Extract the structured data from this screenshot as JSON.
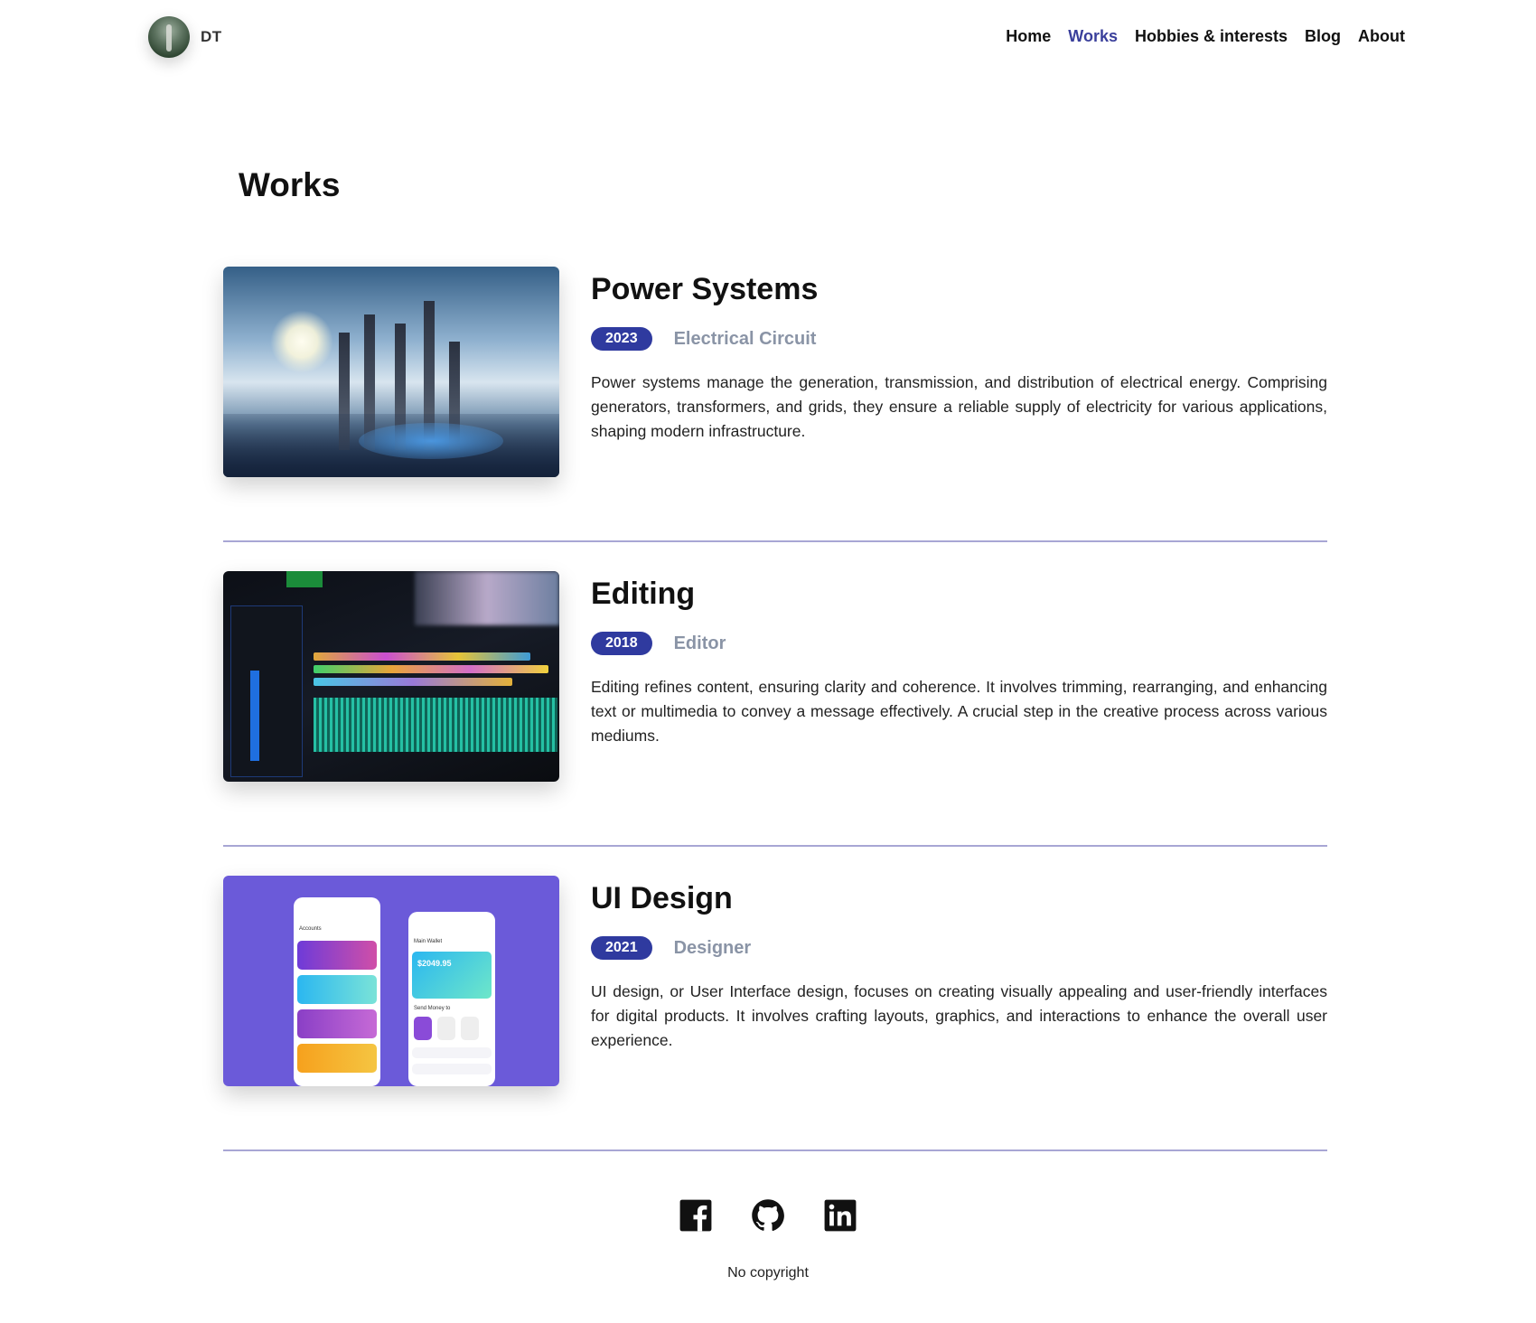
{
  "header": {
    "brand": "DT",
    "nav": [
      {
        "label": "Home"
      },
      {
        "label": "Works",
        "active": true
      },
      {
        "label": "Hobbies & interests"
      },
      {
        "label": "Blog"
      },
      {
        "label": "About"
      }
    ]
  },
  "page": {
    "title": "Works"
  },
  "works": [
    {
      "title": "Power Systems",
      "year": "2023",
      "category": "Electrical Circuit",
      "description": "Power systems manage the generation, transmission, and distribution of electrical energy. Comprising generators, transformers, and grids, they ensure a reliable supply of electricity for various applications, shaping modern infrastructure."
    },
    {
      "title": "Editing",
      "year": "2018",
      "category": "Editor",
      "description": "Editing refines content, ensuring clarity and coherence. It involves trimming, rearranging, and enhancing text or multimedia to convey a message effectively. A crucial step in the creative process across various mediums."
    },
    {
      "title": "UI Design",
      "year": "2021",
      "category": "Designer",
      "description": "UI design, or User Interface design, focuses on creating visually appealing and user-friendly interfaces for digital products. It involves crafting layouts, graphics, and interactions to enhance the overall user experience."
    }
  ],
  "ui_mock": {
    "accounts_label": "Accounts",
    "wallet_label": "Main Wallet",
    "wallet_amount": "$2049.95",
    "send_money_label": "Send Money to"
  },
  "footer": {
    "socials": [
      "facebook-icon",
      "github-icon",
      "linkedin-icon"
    ],
    "copyright": "No copyright"
  },
  "colors": {
    "accent": "#3a3f9b",
    "badge": "#2f3a9f",
    "divider": "#a8a6d4",
    "category": "#8a94a6",
    "ui_bg": "#6b5ad9"
  }
}
